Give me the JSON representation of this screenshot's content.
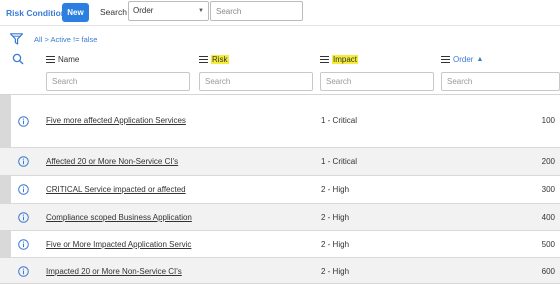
{
  "header": {
    "title": "Risk Conditions",
    "new_label": "New",
    "search_label": "Search",
    "search_field": "Order",
    "search_placeholder": "Search"
  },
  "filter": {
    "all_label": "All",
    "separator": ">",
    "condition": "Active != false"
  },
  "columns": [
    {
      "label": "Name",
      "highlight": false,
      "sorted": false
    },
    {
      "label": "Risk",
      "highlight": true,
      "sorted": false
    },
    {
      "label": "Impact",
      "highlight": true,
      "sorted": false
    },
    {
      "label": "Order",
      "highlight": false,
      "sorted": true,
      "sort_dir": "ascending"
    }
  ],
  "column_search_placeholder": "Search",
  "rows": [
    {
      "name": "Five more affected Application Services",
      "risk": "",
      "impact": "1 - Critical",
      "order": "100"
    },
    {
      "name": "Affected 20 or More Non-Service CI's",
      "risk": "",
      "impact": "1 - Critical",
      "order": "200"
    },
    {
      "name": "CRITICAL Service impacted or affected",
      "risk": "",
      "impact": "2 - High",
      "order": "300"
    },
    {
      "name": "Compliance scoped Business Application",
      "risk": "",
      "impact": "2 - High",
      "order": "400"
    },
    {
      "name": "Five or More Impacted Application Servic",
      "risk": "",
      "impact": "2 - High",
      "order": "500"
    },
    {
      "name": "Impacted 20 or More Non-Service CI's",
      "risk": "",
      "impact": "2 - High",
      "order": "600"
    }
  ],
  "colors": {
    "accent": "#2a7fe0",
    "link": "#3a7bd5",
    "highlight": "#f5ec3a",
    "alt_row": "#f2f2f2"
  }
}
